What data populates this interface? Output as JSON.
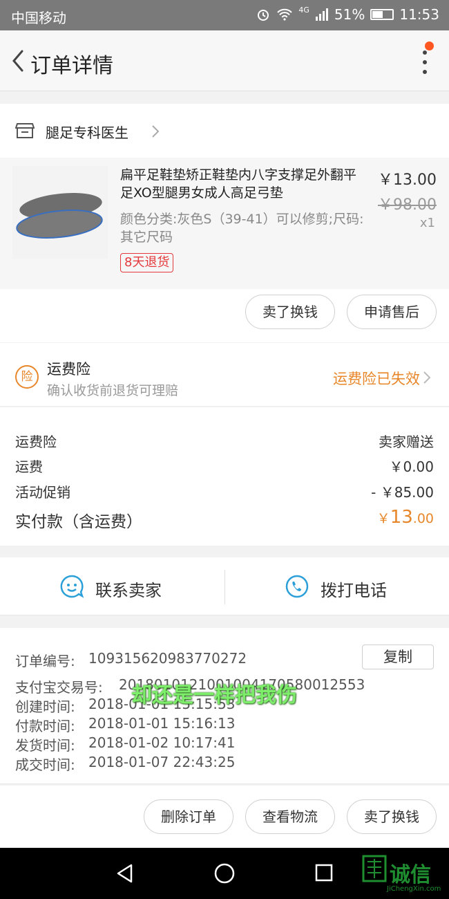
{
  "status_bar": {
    "carrier": "中国移动",
    "network": "4G",
    "battery": "51%",
    "time": "11:53"
  },
  "header": {
    "title": "订单详情"
  },
  "shop": {
    "name": "腿足专科医生"
  },
  "product": {
    "title": "扁平足鞋垫矫正鞋垫内八字支撑足外翻平足XO型腿男女成人高足弓垫",
    "spec": "颜色分类:灰色S（39-41）可以修剪;尺码:其它尺码",
    "return_tag": "8天退货",
    "price_now": "￥13.00",
    "price_old": "￥98.00",
    "quantity": "x1",
    "actions": [
      "卖了换钱",
      "申请售后"
    ]
  },
  "insurance": {
    "badge": "险",
    "title": "运费险",
    "subtitle": "确认收货前退货可理赔",
    "status": "运费险已失效"
  },
  "fees": {
    "rows": [
      {
        "label": "运费险",
        "value": "卖家赠送"
      },
      {
        "label": "运费",
        "value": "￥0.00"
      },
      {
        "label": "活动促销",
        "value": "- ￥85.00"
      }
    ],
    "total_label": "实付款（含运费）",
    "total_currency": "￥",
    "total_int": "13",
    "total_dec": ".00"
  },
  "contact": {
    "seller": "联系卖家",
    "phone": "拨打电话"
  },
  "order_info": {
    "rows": [
      {
        "label": "订单编号:",
        "value": "109315620983770272"
      },
      {
        "label": "支付宝交易号:",
        "value": "2018010121001004170580012553"
      },
      {
        "label": "创建时间:",
        "value": "2018-01-01 15:15:53"
      },
      {
        "label": "付款时间:",
        "value": "2018-01-01 15:16:13"
      },
      {
        "label": "发货时间:",
        "value": "2018-01-02 10:17:41"
      },
      {
        "label": "成交时间:",
        "value": "2018-01-07 22:43:25"
      }
    ],
    "copy_label": "复制",
    "overlay_caption": "却还是一样把我伤"
  },
  "bottom_actions": [
    "删除订单",
    "查看物流",
    "卖了换钱"
  ],
  "watermark": {
    "text": "诚信",
    "sub": "JiChengXin.com"
  },
  "colors": {
    "accent_orange": "#e8872a",
    "tag_red": "#e4393c",
    "icon_blue": "#2a9fd8"
  }
}
